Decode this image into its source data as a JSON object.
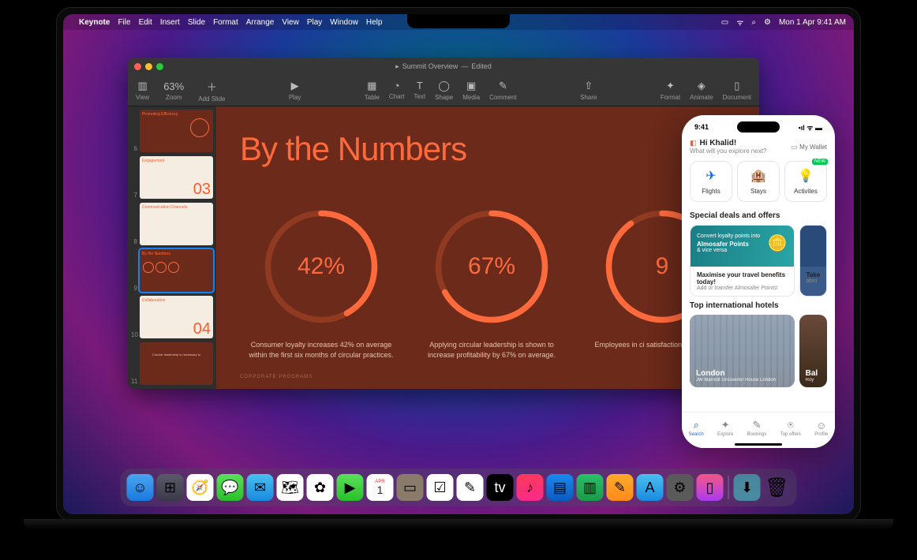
{
  "menubar": {
    "app": "Keynote",
    "items": [
      "File",
      "Edit",
      "Insert",
      "Slide",
      "Format",
      "Arrange",
      "View",
      "Play",
      "Window",
      "Help"
    ],
    "clock": "Mon 1 Apr  9:41 AM"
  },
  "keynote": {
    "doc_title": "Summit Overview",
    "doc_state": "Edited",
    "zoom": "63%",
    "toolbar": {
      "view": "View",
      "zoom": "Zoom",
      "add_slide": "Add Slide",
      "play": "Play",
      "table": "Table",
      "chart": "Chart",
      "text": "Text",
      "shape": "Shape",
      "media": "Media",
      "comment": "Comment",
      "share": "Share",
      "format": "Format",
      "animate": "Animate",
      "document": "Document"
    },
    "thumbs": [
      {
        "n": 6,
        "title": "Promoting Efficiency",
        "bg": "brown"
      },
      {
        "n": 7,
        "title": "Engagement",
        "big": "03",
        "bg": "cream"
      },
      {
        "n": 8,
        "title": "Communication Channels",
        "bg": "cream"
      },
      {
        "n": 9,
        "title": "By the Numbers",
        "bg": "brown",
        "selected": true
      },
      {
        "n": 10,
        "title": "Collaboration",
        "big": "04",
        "bg": "cream"
      },
      {
        "n": 11,
        "title": "Circular leadership is necessary to",
        "bg": "brown"
      }
    ],
    "slide": {
      "title": "By the Numbers",
      "footer": "CORPORATE PROGRAMS",
      "stats": [
        {
          "pct": 42,
          "label": "42%",
          "caption": "Consumer loyalty increases 42% on average within the first six months of circular practices."
        },
        {
          "pct": 67,
          "label": "67%",
          "caption": "Applying circular leadership is shown to increase profitability by 67% on average."
        },
        {
          "pct": 90,
          "label": "9",
          "caption": "Employees in ci satisfaction lev those in no"
        }
      ]
    }
  },
  "phone": {
    "time": "9:41",
    "greeting": "Hi Khalid!",
    "subtitle": "What will you explore next?",
    "wallet": "My Wallet",
    "actions": [
      {
        "label": "Flights",
        "icon": "✈"
      },
      {
        "label": "Stays",
        "icon": "🏨"
      },
      {
        "label": "Activites",
        "icon": "💡",
        "badge": "NEW"
      }
    ],
    "deals_title": "Special deals and offers",
    "promo": {
      "line1": "Convert loyalty points into",
      "line2": "Almosafer Points",
      "line3": "& vice versa",
      "headline": "Maximise your travel benefits today!",
      "sub": "Add or transfer Almosafer Points!"
    },
    "promo_side": {
      "headline": "Take",
      "sub": "abro"
    },
    "hotels_title": "Top international hotels",
    "hotel": {
      "city": "London",
      "name": "JW Marriott Grosvenor House London"
    },
    "hotel_side": {
      "city": "Bal",
      "name": "Roy"
    },
    "tabs": [
      {
        "label": "Search",
        "icon": "⌕",
        "active": true
      },
      {
        "label": "Explore",
        "icon": "✦"
      },
      {
        "label": "Bookings",
        "icon": "✎"
      },
      {
        "label": "Top offers",
        "icon": "⍟"
      },
      {
        "label": "Profile",
        "icon": "☺"
      }
    ]
  },
  "dock": {
    "cal_month": "APR",
    "cal_day": "1"
  },
  "chart_data": {
    "type": "pie",
    "title": "By the Numbers",
    "series": [
      {
        "name": "Consumer loyalty increase",
        "values": [
          42
        ],
        "unit": "%"
      },
      {
        "name": "Profitability increase",
        "values": [
          67
        ],
        "unit": "%"
      },
      {
        "name": "Employee satisfaction (partial)",
        "values": [
          90
        ],
        "unit": "%"
      }
    ]
  }
}
